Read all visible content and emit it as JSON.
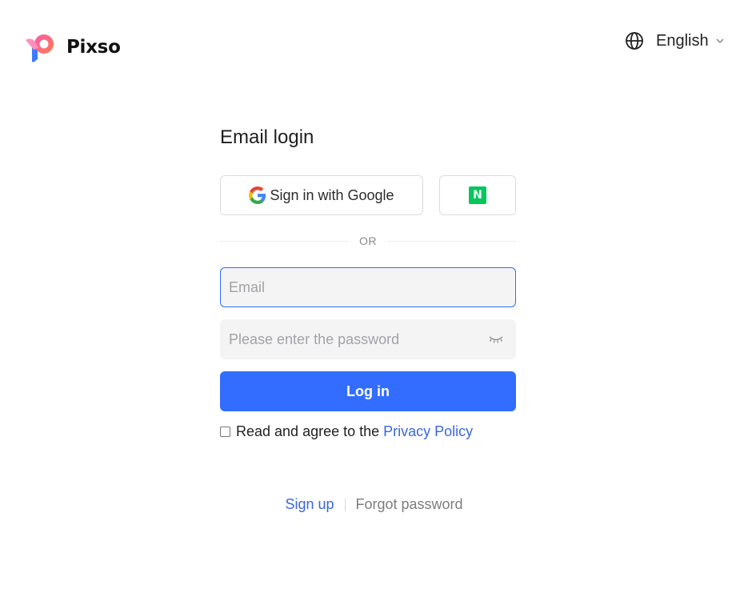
{
  "brand": {
    "name": "Pixso"
  },
  "language": {
    "label": "English",
    "globe_icon": "globe-icon",
    "chevron_icon": "chevron-down-icon"
  },
  "login": {
    "title": "Email login",
    "google_label": "Sign in with Google",
    "naver_letter": "N",
    "or_label": "OR",
    "email_placeholder": "Email",
    "email_value": "",
    "password_placeholder": "Please enter the password",
    "password_value": "",
    "login_label": "Log in",
    "agree_text": "Read and agree to the",
    "privacy_label": "Privacy Policy"
  },
  "footer": {
    "signup_label": "Sign up",
    "forgot_label": "Forgot password"
  },
  "colors": {
    "accent": "#336dff",
    "link": "#3a67e0",
    "naver_green": "#03c75a",
    "field_bg": "#f4f4f5"
  }
}
